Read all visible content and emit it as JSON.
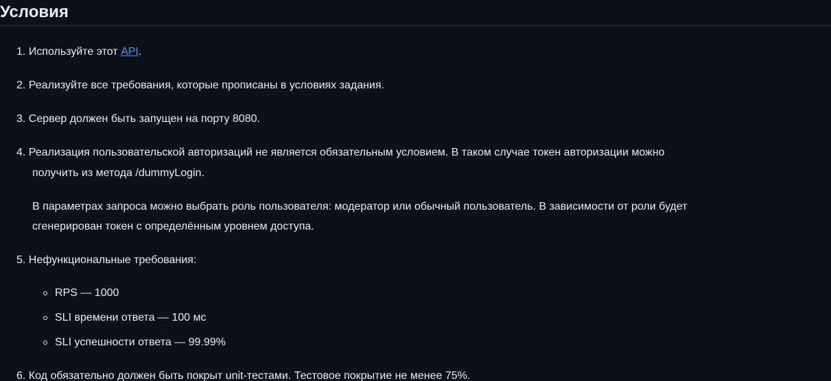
{
  "heading": "Условия",
  "items": [
    {
      "number": "1.",
      "text_before": "Используйте этот",
      "link": "API",
      "text_after": "."
    },
    {
      "number": "2.",
      "text": "Реализуйте все требования, которые прописаны в условиях задания."
    },
    {
      "number": "3.",
      "text": "Сервер должен быть запущен на порту 8080."
    },
    {
      "number": "4.",
      "line1": "Реализация пользовательской авторизаций не является обязательным условием. В таком случае токен авторизации можно",
      "line2": "получить из метода /dummyLogin.",
      "para_line1": "В параметрах запроса можно выбрать роль пользователя: модератор или обычный пользователь. В зависимости от роли будет",
      "para_line2": "сгенерирован токен с определённым уровнем доступа."
    },
    {
      "number": "5.",
      "text": "Нефункциональные требования:",
      "subitems": [
        "RPS — 1000",
        "SLI времени ответа — 100 мс",
        "SLI успешности ответа — 99.99%"
      ]
    },
    {
      "number": "6.",
      "text": "Код обязательно должен быть покрыт unit-тестами. Тестовое покрытие не менее 75%."
    }
  ]
}
